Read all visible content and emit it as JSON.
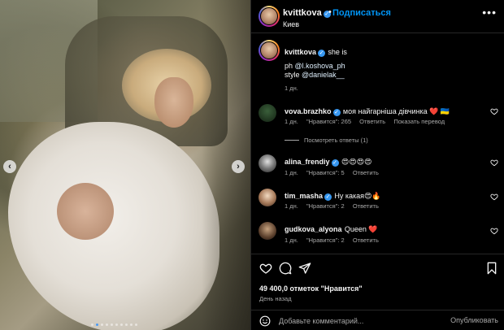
{
  "photo": {
    "nav_prev": "‹",
    "nav_next": "›",
    "dots_count": 10,
    "active_dot": 1
  },
  "post_header": {
    "username": "kvittkova",
    "separator": "•",
    "follow_label": "Подписаться",
    "location": "Киев",
    "more_label": "•••"
  },
  "caption": {
    "username": "kvittkova",
    "text": "she is",
    "ph_prefix": "ph ",
    "ph_link": "@l.koshova_ph",
    "style_prefix": "style ",
    "style_link": "@danielak__",
    "time": "1 дн."
  },
  "comments": [
    {
      "username": "vova.brazhko",
      "verified": true,
      "text": "моя найгарніша дівчинка ❤️ 🇺🇦",
      "time": "1 дн.",
      "likes": "\"Нравится\": 265",
      "reply": "Ответить",
      "translate": "Показать перевод"
    },
    {
      "username": "alina_frendiy",
      "verified": true,
      "text": "😍😍😍😍",
      "time": "1 дн.",
      "likes": "\"Нравится\": 5",
      "reply": "Ответить"
    },
    {
      "username": "tim_masha",
      "verified": true,
      "text": "Ну какая😍🔥",
      "time": "1 дн.",
      "likes": "\"Нравится\": 2",
      "reply": "Ответить"
    },
    {
      "username": "gudkova_alyona",
      "verified": false,
      "text": "Queen ❤️",
      "time": "1 дн.",
      "likes": "\"Нравится\": 2",
      "reply": "Ответить"
    }
  ],
  "view_replies": "Посмотреть ответы (1)",
  "actions": {
    "likes_text": "49 400,0 отметок \"Нравится\"",
    "when": "День назад"
  },
  "add_comment": {
    "placeholder": "Добавьте комментарий...",
    "publish_label": "Опубликовать"
  },
  "colors": {
    "accent": "#0095f6",
    "verified": "#3797f0",
    "background": "#000000",
    "muted_text": "#a8a8a8"
  }
}
